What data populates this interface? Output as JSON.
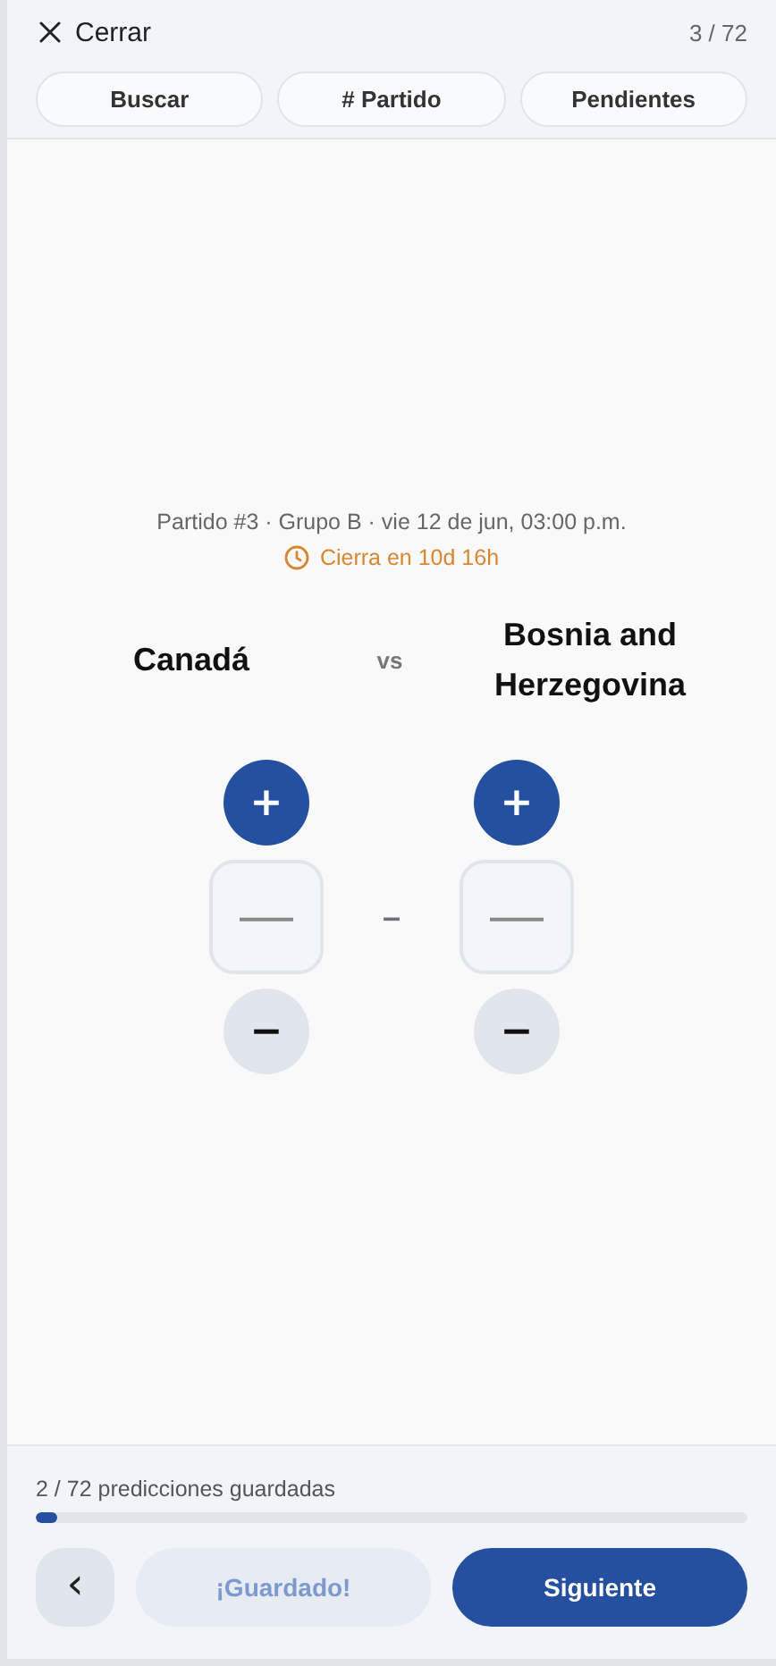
{
  "header": {
    "close_label": "Cerrar",
    "counter": "3 / 72",
    "tabs": [
      {
        "label": "Buscar",
        "selected": false
      },
      {
        "label": "# Partido",
        "selected": false
      },
      {
        "label": "Pendientes",
        "selected": false
      }
    ]
  },
  "match": {
    "info": "Partido #3 · Grupo B · vie 12 de jun, 03:00 p.m.",
    "countdown": "Cierra en 10d 16h",
    "home": "Canadá",
    "vs": "vs",
    "away": "Bosnia and Herzegovina",
    "separator": "–",
    "scores": [
      {
        "plus": "+",
        "value": "—",
        "minus": "−"
      },
      {
        "plus": "+",
        "value": "—",
        "minus": "−"
      }
    ]
  },
  "footer": {
    "progress_label": "2 / 72 predicciones guardadas",
    "level": 0.03,
    "back": "‹",
    "save": {
      "label": "¡Guardado!",
      "disabled": true
    },
    "next": "Siguiente"
  }
}
